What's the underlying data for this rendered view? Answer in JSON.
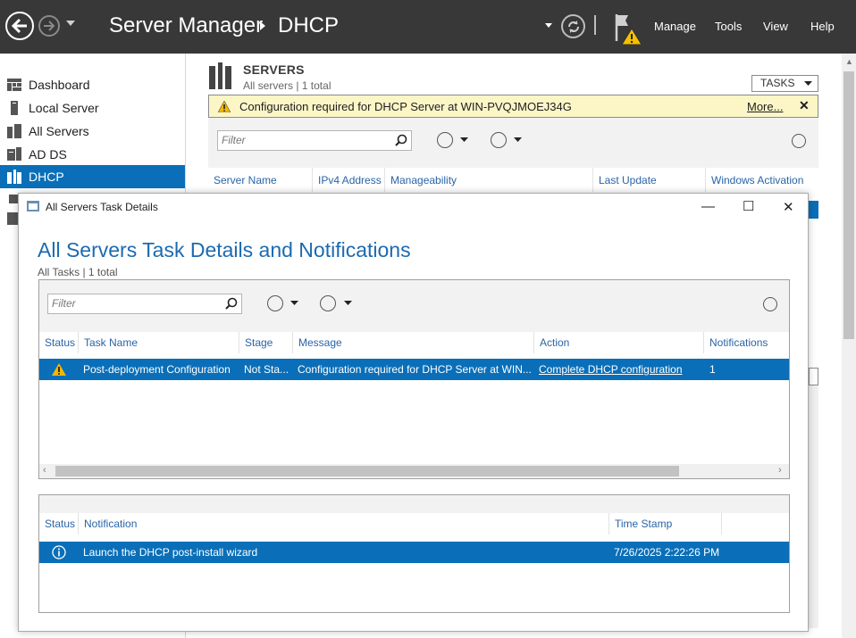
{
  "titlebar": {
    "app_title": "Server Manager",
    "crumb": "DHCP",
    "menus": [
      "Manage",
      "Tools",
      "View",
      "Help"
    ]
  },
  "sidebar": {
    "items": [
      {
        "label": "Dashboard",
        "icon": "dashboard-icon"
      },
      {
        "label": "Local Server",
        "icon": "server-icon"
      },
      {
        "label": "All Servers",
        "icon": "servers-icon"
      },
      {
        "label": "AD DS",
        "icon": "adds-icon"
      },
      {
        "label": "DHCP",
        "icon": "dhcp-icon",
        "active": true
      }
    ]
  },
  "servers": {
    "title": "SERVERS",
    "subtitle": "All servers | 1 total",
    "tasks_label": "TASKS",
    "warning_text": "Configuration required for DHCP Server at WIN-PVQJMOEJ34G",
    "warning_more": "More...",
    "filter_placeholder": "Filter",
    "columns": [
      "Server Name",
      "IPv4 Address",
      "Manageability",
      "Last Update",
      "Windows Activation"
    ]
  },
  "dialog": {
    "window_title": "All Servers Task Details",
    "heading": "All Servers Task Details and Notifications",
    "subheading": "All Tasks | 1 total",
    "filter_placeholder": "Filter",
    "task_columns": [
      "Status",
      "Task Name",
      "Stage",
      "Message",
      "Action",
      "Notifications"
    ],
    "task_row": {
      "task_name": "Post-deployment Configuration",
      "stage": "Not Sta...",
      "message": "Configuration required for DHCP Server at WIN...",
      "action": "Complete DHCP configuration",
      "notifications": "1"
    },
    "notif_columns": [
      "Status",
      "Notification",
      "Time Stamp"
    ],
    "notif_row": {
      "notification": "Launch the DHCP post-install wizard",
      "timestamp": "7/26/2025 2:22:26 PM"
    }
  },
  "colors": {
    "titlebar": "#383838",
    "accent": "#0a6fb8",
    "heading": "#1c6ab0",
    "warning_bg": "#fcf6c7"
  }
}
